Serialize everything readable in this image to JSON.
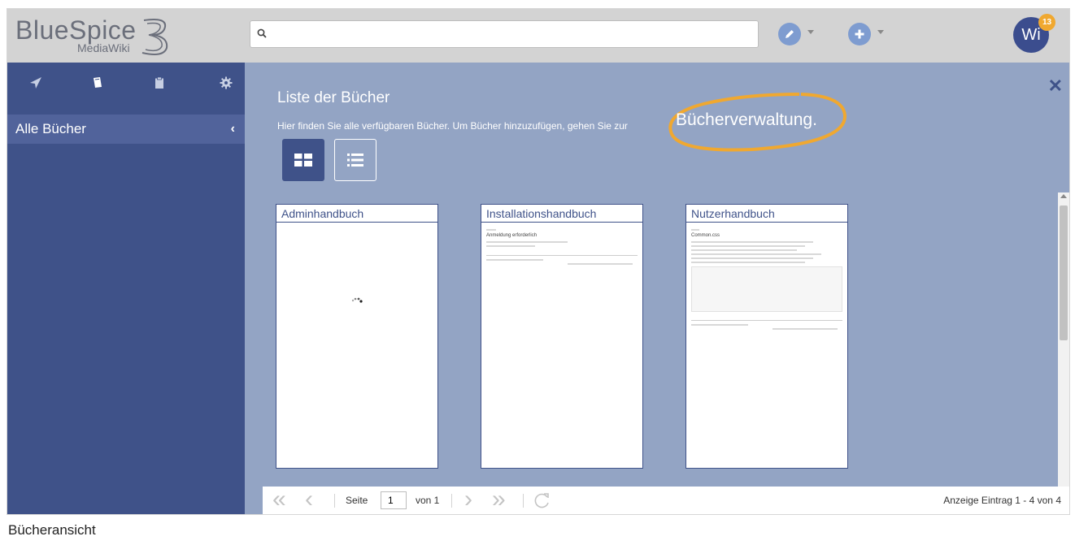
{
  "brand": {
    "logo_text": "BlueSpice",
    "logo_sub": "MediaWiki",
    "logo_version": "3"
  },
  "search": {
    "placeholder": "",
    "value": ""
  },
  "header": {
    "edit_icon": "pencil-icon",
    "add_icon": "plus-icon",
    "user_initials": "Wi",
    "notification_count": "13"
  },
  "sidebar": {
    "tools": [
      "navigation-icon",
      "books-icon",
      "clipboard-icon",
      "gear-icon"
    ],
    "panel_title": "Alle Bücher"
  },
  "main": {
    "title": "Liste der Bücher",
    "description": "Hier finden Sie alle verfügbaren Bücher. Um Bücher hinzuzufügen, gehen Sie zur",
    "highlight_link": "Bücherverwaltung",
    "highlight_suffix": ".",
    "views": [
      "grid-view-icon",
      "list-view-icon"
    ]
  },
  "books": [
    {
      "title": "Adminhandbuch",
      "preview_heading": ""
    },
    {
      "title": "Installationshandbuch",
      "preview_heading": "Anmeldung erforderlich"
    },
    {
      "title": "Nutzerhandbuch",
      "preview_heading": "Common.css"
    }
  ],
  "pager": {
    "page_label": "Seite",
    "page_value": "1",
    "of_label": "von 1",
    "status": "Anzeige Eintrag 1 - 4 von 4"
  },
  "caption": "Bücheransicht",
  "colors": {
    "sidebar": "#3f5289",
    "main_bg": "#93a4c4",
    "accent_ring": "#f0a830",
    "badge": "#f0a830"
  }
}
